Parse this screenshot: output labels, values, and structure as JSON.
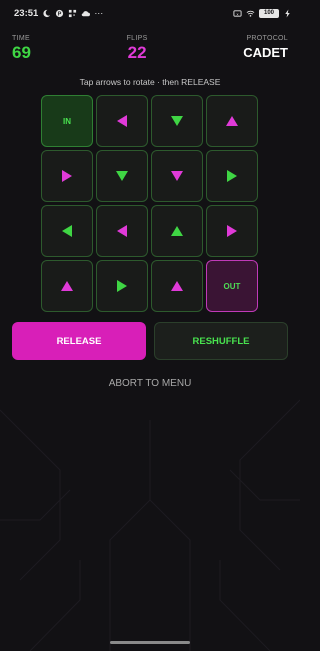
{
  "status_bar": {
    "time": "23:51",
    "battery": "100",
    "more": "···"
  },
  "stats": {
    "time_label": "TIME",
    "time_value": "69",
    "flips_label": "FLIPS",
    "flips_value": "22",
    "protocol_label": "PROTOCOL",
    "protocol_value": "CADET"
  },
  "hint": "Tap arrows to rotate · then RELEASE",
  "grid": {
    "rows": [
      [
        {
          "type": "label",
          "text": "IN",
          "kind": "in"
        },
        {
          "type": "arrow",
          "dir": "left",
          "color": "magenta"
        },
        {
          "type": "arrow",
          "dir": "down",
          "color": "green"
        },
        {
          "type": "arrow",
          "dir": "up",
          "color": "magenta"
        }
      ],
      [
        {
          "type": "arrow",
          "dir": "right",
          "color": "magenta"
        },
        {
          "type": "arrow",
          "dir": "down",
          "color": "green"
        },
        {
          "type": "arrow",
          "dir": "down",
          "color": "magenta"
        },
        {
          "type": "arrow",
          "dir": "right",
          "color": "green"
        }
      ],
      [
        {
          "type": "arrow",
          "dir": "left",
          "color": "green"
        },
        {
          "type": "arrow",
          "dir": "left",
          "color": "magenta"
        },
        {
          "type": "arrow",
          "dir": "up",
          "color": "green"
        },
        {
          "type": "arrow",
          "dir": "right",
          "color": "magenta"
        }
      ],
      [
        {
          "type": "arrow",
          "dir": "up",
          "color": "magenta"
        },
        {
          "type": "arrow",
          "dir": "right",
          "color": "green"
        },
        {
          "type": "arrow",
          "dir": "up",
          "color": "magenta"
        },
        {
          "type": "label",
          "text": "OUT",
          "kind": "out"
        }
      ]
    ]
  },
  "buttons": {
    "release": "RELEASE",
    "reshuffle": "RESHUFFLE",
    "abort": "ABORT TO MENU"
  },
  "colors": {
    "green": "#3fd644",
    "magenta": "#e03ad8",
    "release_bg": "#d81fb8",
    "background": "#121114"
  }
}
